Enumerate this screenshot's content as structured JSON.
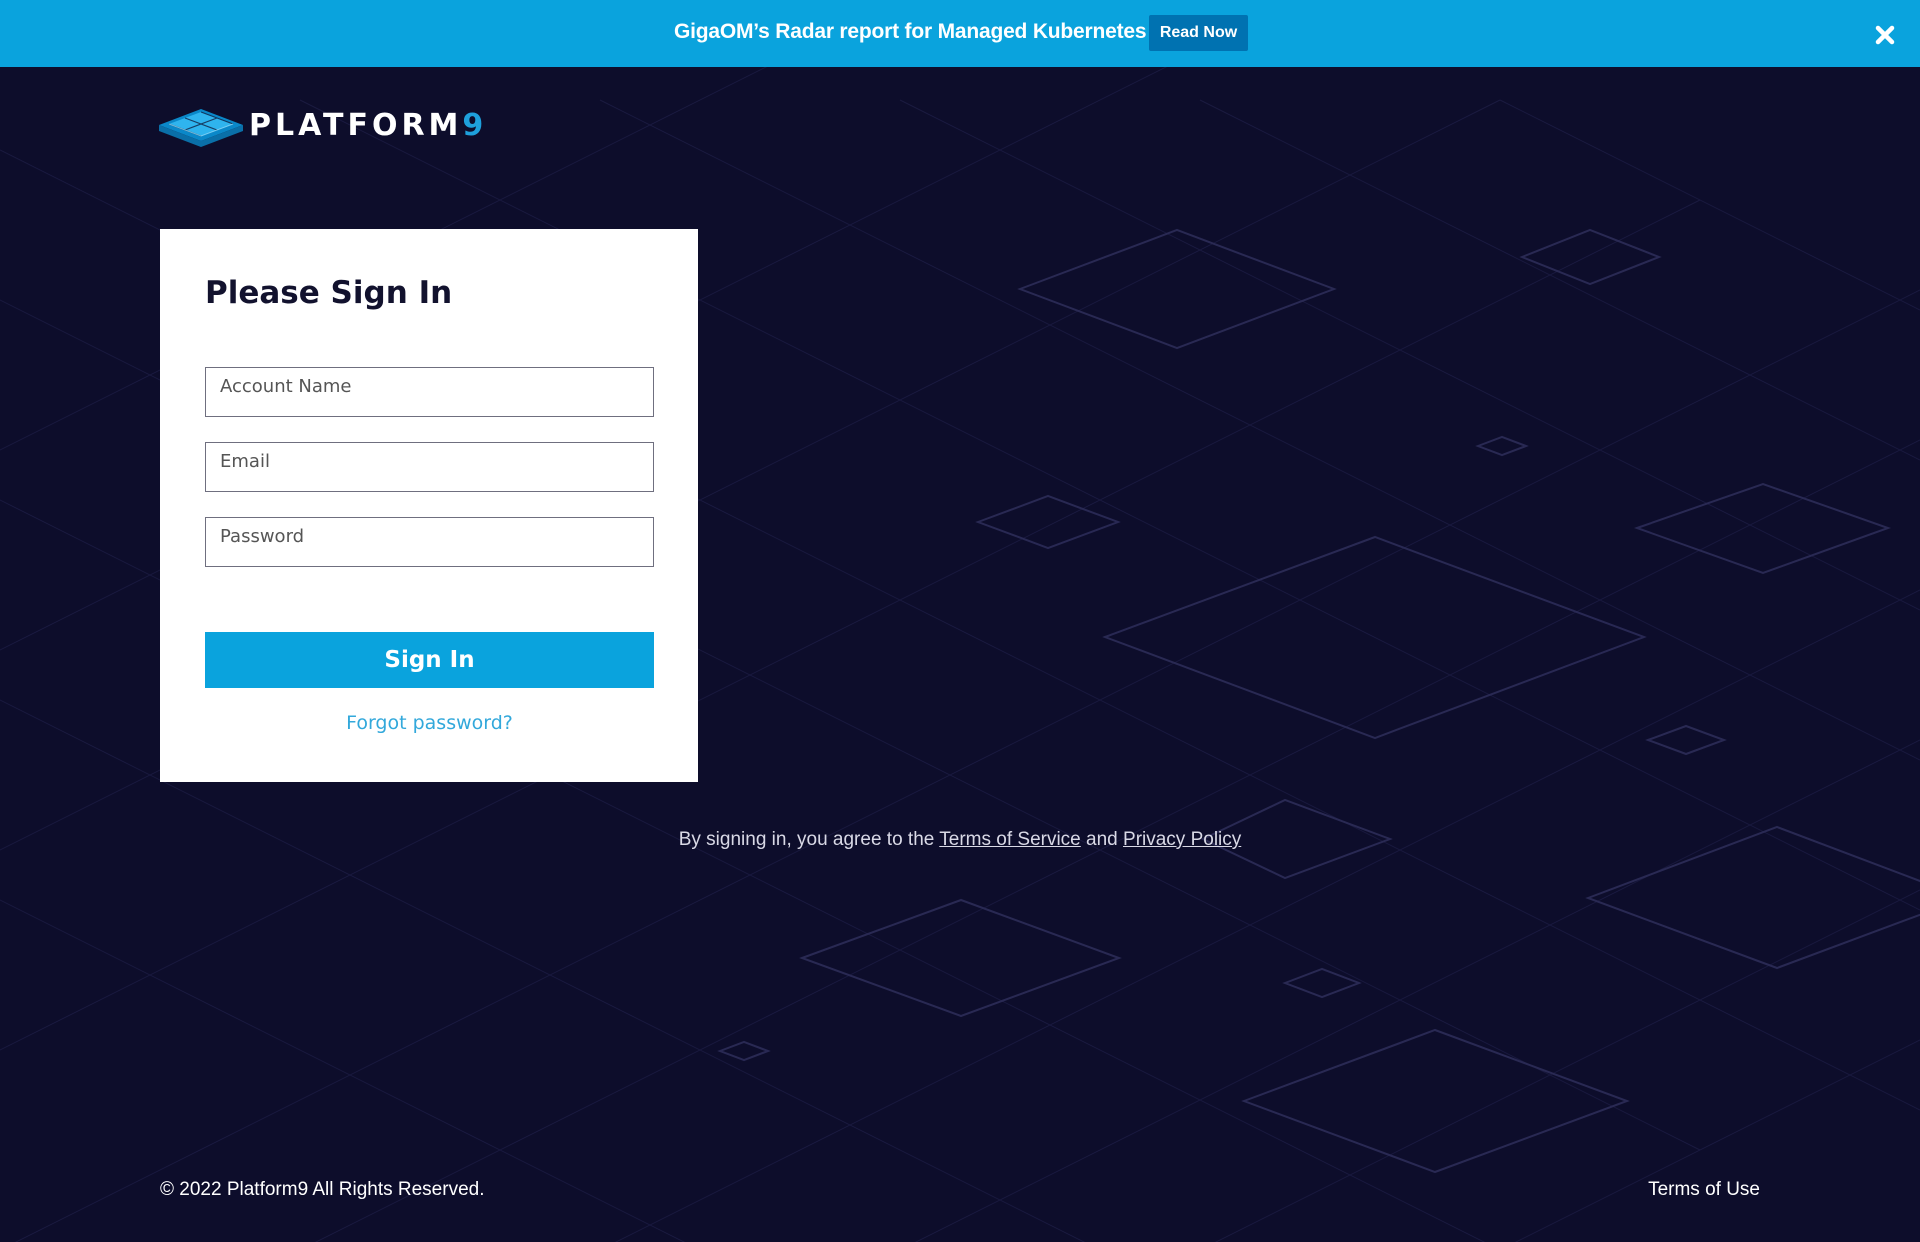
{
  "banner": {
    "text": "GigaOM’s Radar report for Managed Kubernetes",
    "cta_label": "Read Now",
    "close_icon": "close-icon",
    "background_color": "#0aa3dd",
    "cta_color": "#0072b1"
  },
  "brand": {
    "name_main": "PLATFORM",
    "name_accent": "9",
    "logo_icon": "platform9-logo-icon",
    "accent_color": "#1ea0dc"
  },
  "signin": {
    "title": "Please Sign In",
    "account_placeholder": "Account Name",
    "email_placeholder": "Email",
    "password_placeholder": "Password",
    "button_label": "Sign In",
    "forgot_label": "Forgot password?",
    "button_color": "#0aa3dd"
  },
  "legal": {
    "prefix": "By signing in, you agree to the ",
    "terms_label": "Terms of Service",
    "and": " and ",
    "privacy_label": "Privacy Policy"
  },
  "footer": {
    "copyright": "© 2022 Platform9 All Rights Reserved.",
    "terms_of_use": "Terms of Use"
  },
  "theme": {
    "background": "#0d0d2b"
  }
}
